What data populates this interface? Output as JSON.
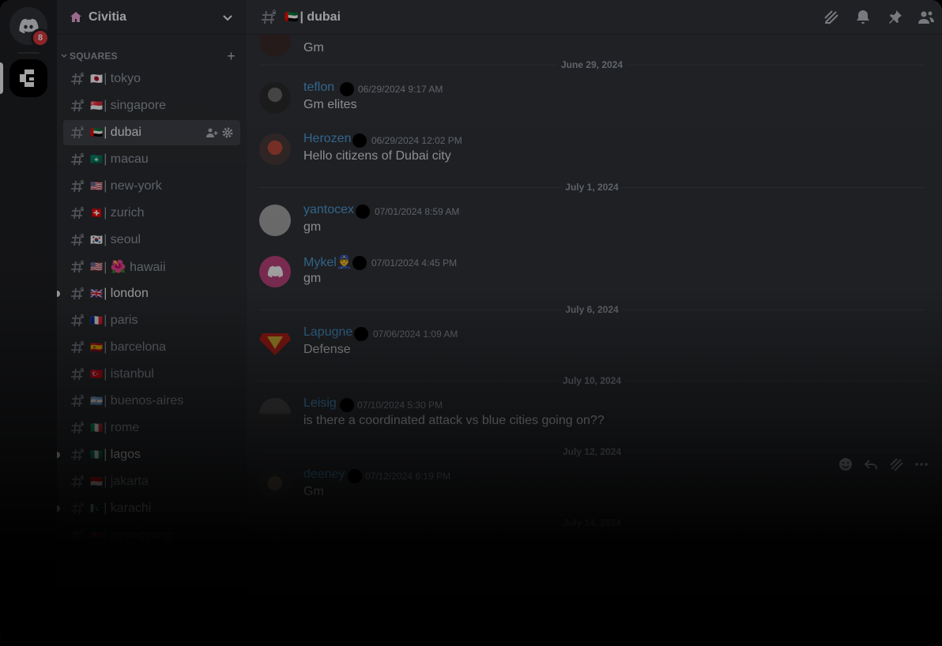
{
  "server_rail": {
    "home_badge": "8"
  },
  "sidebar": {
    "server_name": "Civitia",
    "category": "SQUARES",
    "channels": [
      {
        "flag": "🇯🇵",
        "name": "| tokyo"
      },
      {
        "flag": "🇸🇬",
        "name": "| singapore"
      },
      {
        "flag": "🇦🇪",
        "name": "| dubai"
      },
      {
        "flag": "🇲🇴",
        "name": "| macau"
      },
      {
        "flag": "🇺🇸",
        "name": "| new-york"
      },
      {
        "flag": "🇨🇭",
        "name": "| zurich"
      },
      {
        "flag": "🇰🇷",
        "name": "| seoul"
      },
      {
        "flag": "🇺🇸",
        "name": "| 🌺 hawaii"
      },
      {
        "flag": "🇬🇧",
        "name": "| london"
      },
      {
        "flag": "🇫🇷",
        "name": "| paris"
      },
      {
        "flag": "🇪🇸",
        "name": "| barcelona"
      },
      {
        "flag": "🇹🇷",
        "name": "| istanbul"
      },
      {
        "flag": "🇦🇷",
        "name": "| buenos-aires"
      },
      {
        "flag": "🇮🇹",
        "name": "| rome"
      },
      {
        "flag": "🇳🇬",
        "name": "| lagos"
      },
      {
        "flag": "🇮🇩",
        "name": "| jakarta"
      },
      {
        "flag": "🇵🇰",
        "name": "| karachi"
      },
      {
        "flag": "🇰🇵",
        "name": "| pyongyang"
      }
    ]
  },
  "header": {
    "flag": "🇦🇪",
    "channel": "| dubai"
  },
  "messages": {
    "top_partial": "Gm",
    "dates": [
      "June 29, 2024",
      "July 1, 2024",
      "July 6, 2024",
      "July 10, 2024",
      "July 12, 2024",
      "July 14, 2024"
    ],
    "items": [
      {
        "user": "teflon",
        "ts": "06/29/2024 9:17 AM",
        "text": "Gm elites"
      },
      {
        "user": "Herozen",
        "ts": "06/29/2024 12:02 PM",
        "text": "Hello citizens of Dubai city"
      },
      {
        "user": "yantocex",
        "ts": "07/01/2024 8:59 AM",
        "text": "gm"
      },
      {
        "user": "Mykel👮",
        "ts": "07/01/2024 4:45 PM",
        "text": "gm"
      },
      {
        "user": "Lapugne",
        "ts": "07/06/2024 1:09 AM",
        "text": "Defense"
      },
      {
        "user": "Leisig",
        "ts": "07/10/2024 5:30 PM",
        "text": "is there a coordinated attack vs blue cities going on??"
      },
      {
        "user": "deeney",
        "ts": "07/12/2024 6:19 PM",
        "text": "Gm"
      }
    ]
  },
  "colors": {
    "username": "#4e9fdb",
    "badge": "#da373c",
    "active_channel": "#404249"
  }
}
